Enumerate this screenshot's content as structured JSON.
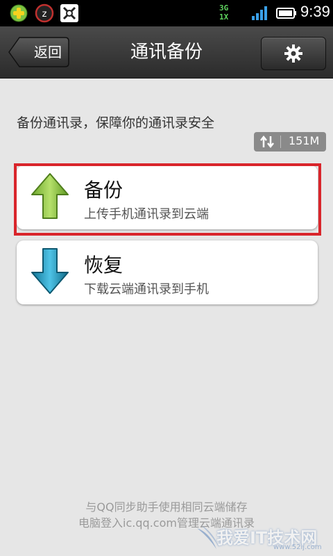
{
  "status_bar": {
    "network_top": "3G",
    "network_bottom": "1X",
    "time": "9:39"
  },
  "header": {
    "back_label": "返回",
    "title": "通讯备份"
  },
  "description": "备份通讯录，保障你的通讯录安全",
  "data_badge": {
    "value": "151M"
  },
  "actions": [
    {
      "title": "备份",
      "subtitle": "上传手机通讯录到云端",
      "icon": "arrow-up-icon",
      "color": "#8bc34a"
    },
    {
      "title": "恢复",
      "subtitle": "下载云端通讯录到手机",
      "icon": "arrow-down-icon",
      "color": "#1e90b8"
    }
  ],
  "footer": {
    "line1": "与QQ同步助手使用相同云端储存",
    "line2": "电脑登入ic.qq.com管理云端通讯录"
  },
  "watermark": {
    "text": "我爱IT技术网",
    "sub": "www.52ij.com"
  },
  "colors": {
    "highlight": "#d9252b",
    "title_bar": "#333333",
    "background": "#e6e6e6"
  }
}
